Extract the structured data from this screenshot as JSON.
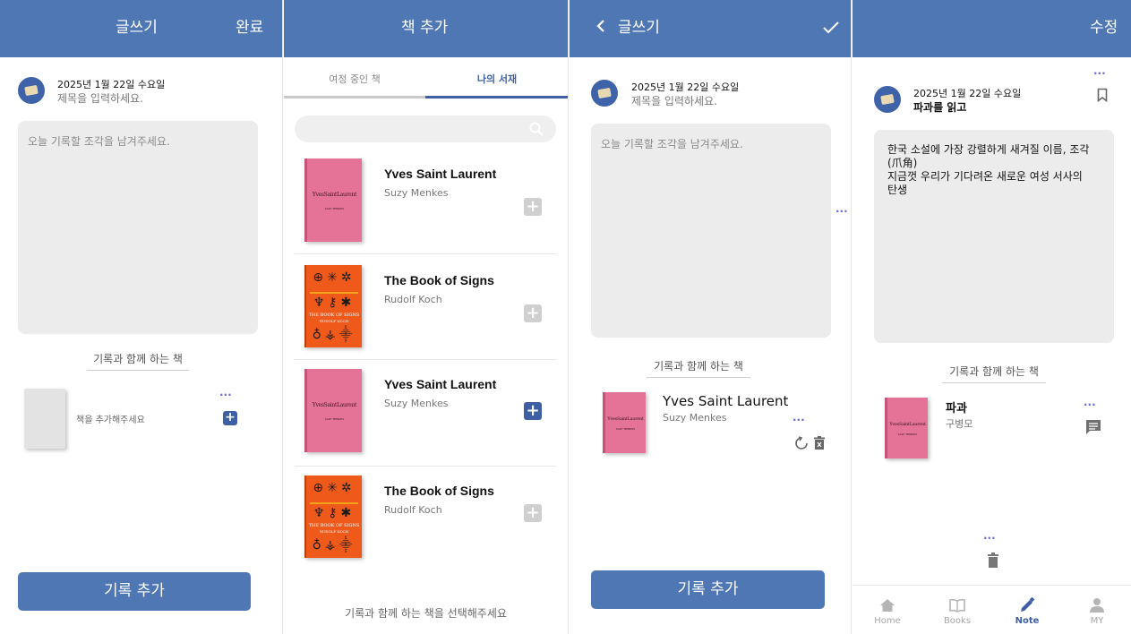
{
  "panel1": {
    "header_title": "글쓰기",
    "header_action": "완료",
    "date": "2025년 1월 22일 수요일",
    "title_placeholder": "제목을 입력하세요.",
    "body_placeholder": "오늘 기록할 조각을 남겨주세요.",
    "section_label": "기록과 함께 하는 책",
    "empty_book_text": "책을 추가해주세요",
    "submit_label": "기록 추가"
  },
  "panel2": {
    "header_title": "책 추가",
    "tabs": [
      "여정 중인 책",
      "나의 서재"
    ],
    "active_tab": 1,
    "books": [
      {
        "title": "Yves Saint Laurent",
        "author": "Suzy Menkes",
        "selected": false
      },
      {
        "title": "The Book of Signs",
        "author": "Rudolf Koch",
        "selected": false
      },
      {
        "title": "Yves Saint Laurent",
        "author": "Suzy Menkes",
        "selected": true
      },
      {
        "title": "The Book of Signs",
        "author": "Rudolf Koch",
        "selected": false
      }
    ],
    "footer_hint": "기록과 함께 하는 책을 선택해주세요"
  },
  "panel3": {
    "header_title": "글쓰기",
    "date": "2025년 1월 22일 수요일",
    "title_placeholder": "제목을 입력하세요.",
    "body_placeholder": "오늘 기록할 조각을 남겨주세요.",
    "section_label": "기록과 함께 하는 책",
    "book": {
      "title": "Yves Saint Laurent",
      "author": "Suzy Menkes"
    },
    "submit_label": "기록 추가"
  },
  "panel4": {
    "header_action": "수정",
    "date": "2025년 1월 22일 수요일",
    "note_title": "파과를 읽고",
    "note_lines": [
      "한국 소설에 가장 강렬하게 새겨질 이름, 조각",
      "(爪角)",
      "지금껏 우리가 기다려온 새로운 여성 서사의",
      "탄생"
    ],
    "section_label": "기록과 함께 하는 책",
    "book": {
      "title": "파과",
      "author": "구병모"
    },
    "nav": [
      {
        "label": "Home",
        "icon": "home-icon"
      },
      {
        "label": "Books",
        "icon": "book-icon"
      },
      {
        "label": "Note",
        "icon": "pencil-icon"
      },
      {
        "label": "MY",
        "icon": "person-icon"
      }
    ],
    "active_nav": 2
  },
  "colors": {
    "header": "#4f77b3",
    "accent_dots": "#6b6bd6",
    "active": "#3e5fa3"
  },
  "cover_text": {
    "ysl": "YvesSaintLaurent",
    "ysl_sub": "SUZY MENKES",
    "signs": "THE BOOK OF SIGNS",
    "signs_sub": "RUDOLF KOCH"
  }
}
